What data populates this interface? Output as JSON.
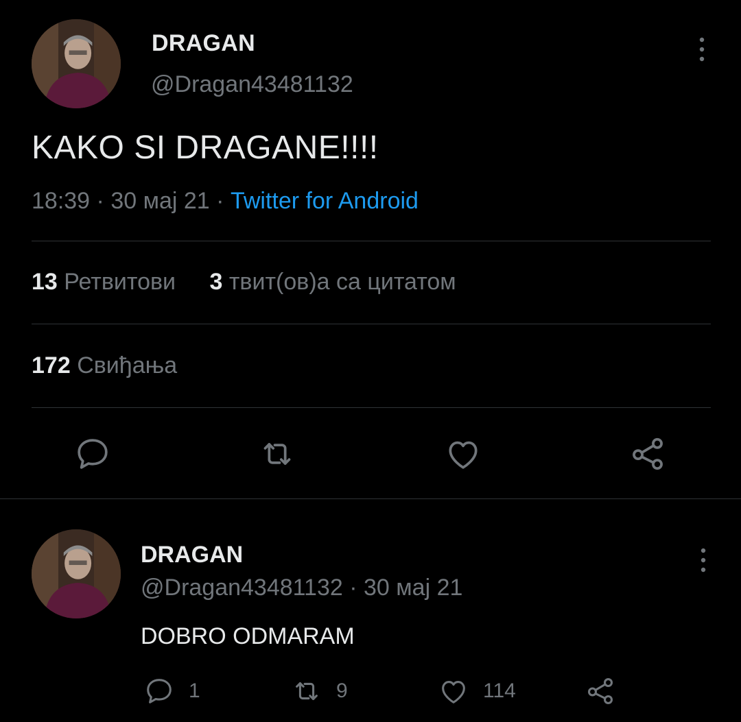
{
  "main_tweet": {
    "author_name": "DRAGAN",
    "author_handle": "@Dragan43481132",
    "text": "KAKO SI DRAGANE!!!!",
    "time": "18:39",
    "separator": "·",
    "date": "30 мај 21",
    "source": "Twitter for Android",
    "retweets_count": "13",
    "retweets_label": "Ретвитови",
    "quotes_count": "3",
    "quotes_label": "твит(ов)а са цитатом",
    "likes_count": "172",
    "likes_label": "Свиђања",
    "icons": {
      "more": "more-vertical-icon",
      "reply": "reply-icon",
      "retweet": "retweet-icon",
      "like": "heart-icon",
      "share": "share-icon"
    }
  },
  "reply_tweet": {
    "author_name": "DRAGAN",
    "author_handle": "@Dragan43481132",
    "separator": "·",
    "date": "30 мај 21",
    "text": "DOBRO ODMARAM",
    "reply_count": "1",
    "retweet_count": "9",
    "like_count": "114"
  },
  "colors": {
    "background": "#000000",
    "primary_text": "#e7e9ea",
    "secondary_text": "#71767b",
    "link": "#1d9bf0",
    "divider": "#2f3336"
  }
}
